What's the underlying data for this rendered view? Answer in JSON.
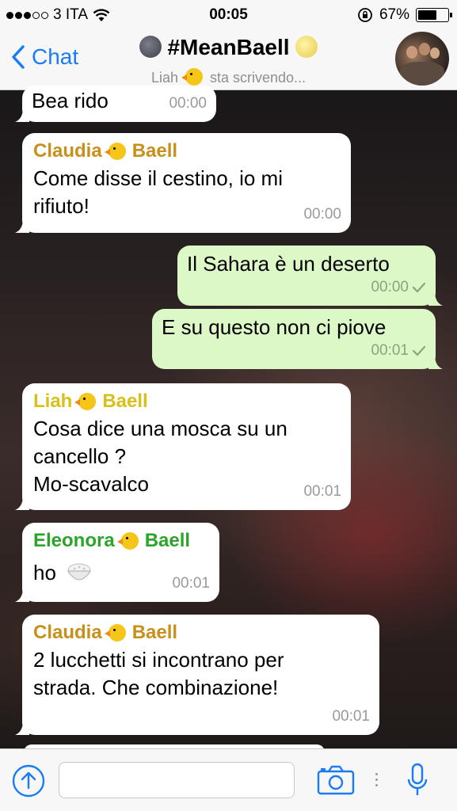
{
  "status_bar": {
    "carrier": "3 ITA",
    "time": "00:05",
    "battery": "67%",
    "battery_level": 0.67,
    "signal_bars": 3
  },
  "nav": {
    "back_label": "Chat",
    "title": "#MeanBaell",
    "subtitle_name": "Liah",
    "subtitle_status": "sta scrivendo..."
  },
  "messages": [
    {
      "direction": "in",
      "sender": "",
      "text": "Bea rido",
      "time": "00:00"
    },
    {
      "direction": "in",
      "sender": "Claudia",
      "sender_suffix": "Baell",
      "sender_color": "#c8901a",
      "text": "Come disse il cestino, io mi rifiuto!",
      "time": "00:00"
    },
    {
      "direction": "out",
      "text": "Il Sahara è un deserto",
      "time": "00:00",
      "status": "sent"
    },
    {
      "direction": "out",
      "text": "E su questo non ci piove",
      "time": "00:01",
      "status": "sent"
    },
    {
      "direction": "in",
      "sender": "Liah",
      "sender_suffix": "Baell",
      "sender_color": "#d8c018",
      "text_lines": [
        "Cosa dice una mosca su un",
        "cancello ?",
        "Mo-scavalco"
      ],
      "time": "00:01"
    },
    {
      "direction": "in",
      "sender": "Eleonora",
      "sender_suffix": "Baell",
      "sender_color": "#2aa52a",
      "text": "ho",
      "time": "00:01"
    },
    {
      "direction": "in",
      "sender": "Claudia",
      "sender_suffix": "Baell",
      "sender_color": "#c8901a",
      "text_lines": [
        "2 lucchetti si incontrano per",
        "strada. Che combinazione!"
      ],
      "time": "00:01"
    }
  ],
  "input": {
    "placeholder": ""
  },
  "colors": {
    "accent": "#1a7cf5",
    "outgoing_bubble": "#dcf8c6",
    "incoming_bubble": "#ffffff"
  }
}
